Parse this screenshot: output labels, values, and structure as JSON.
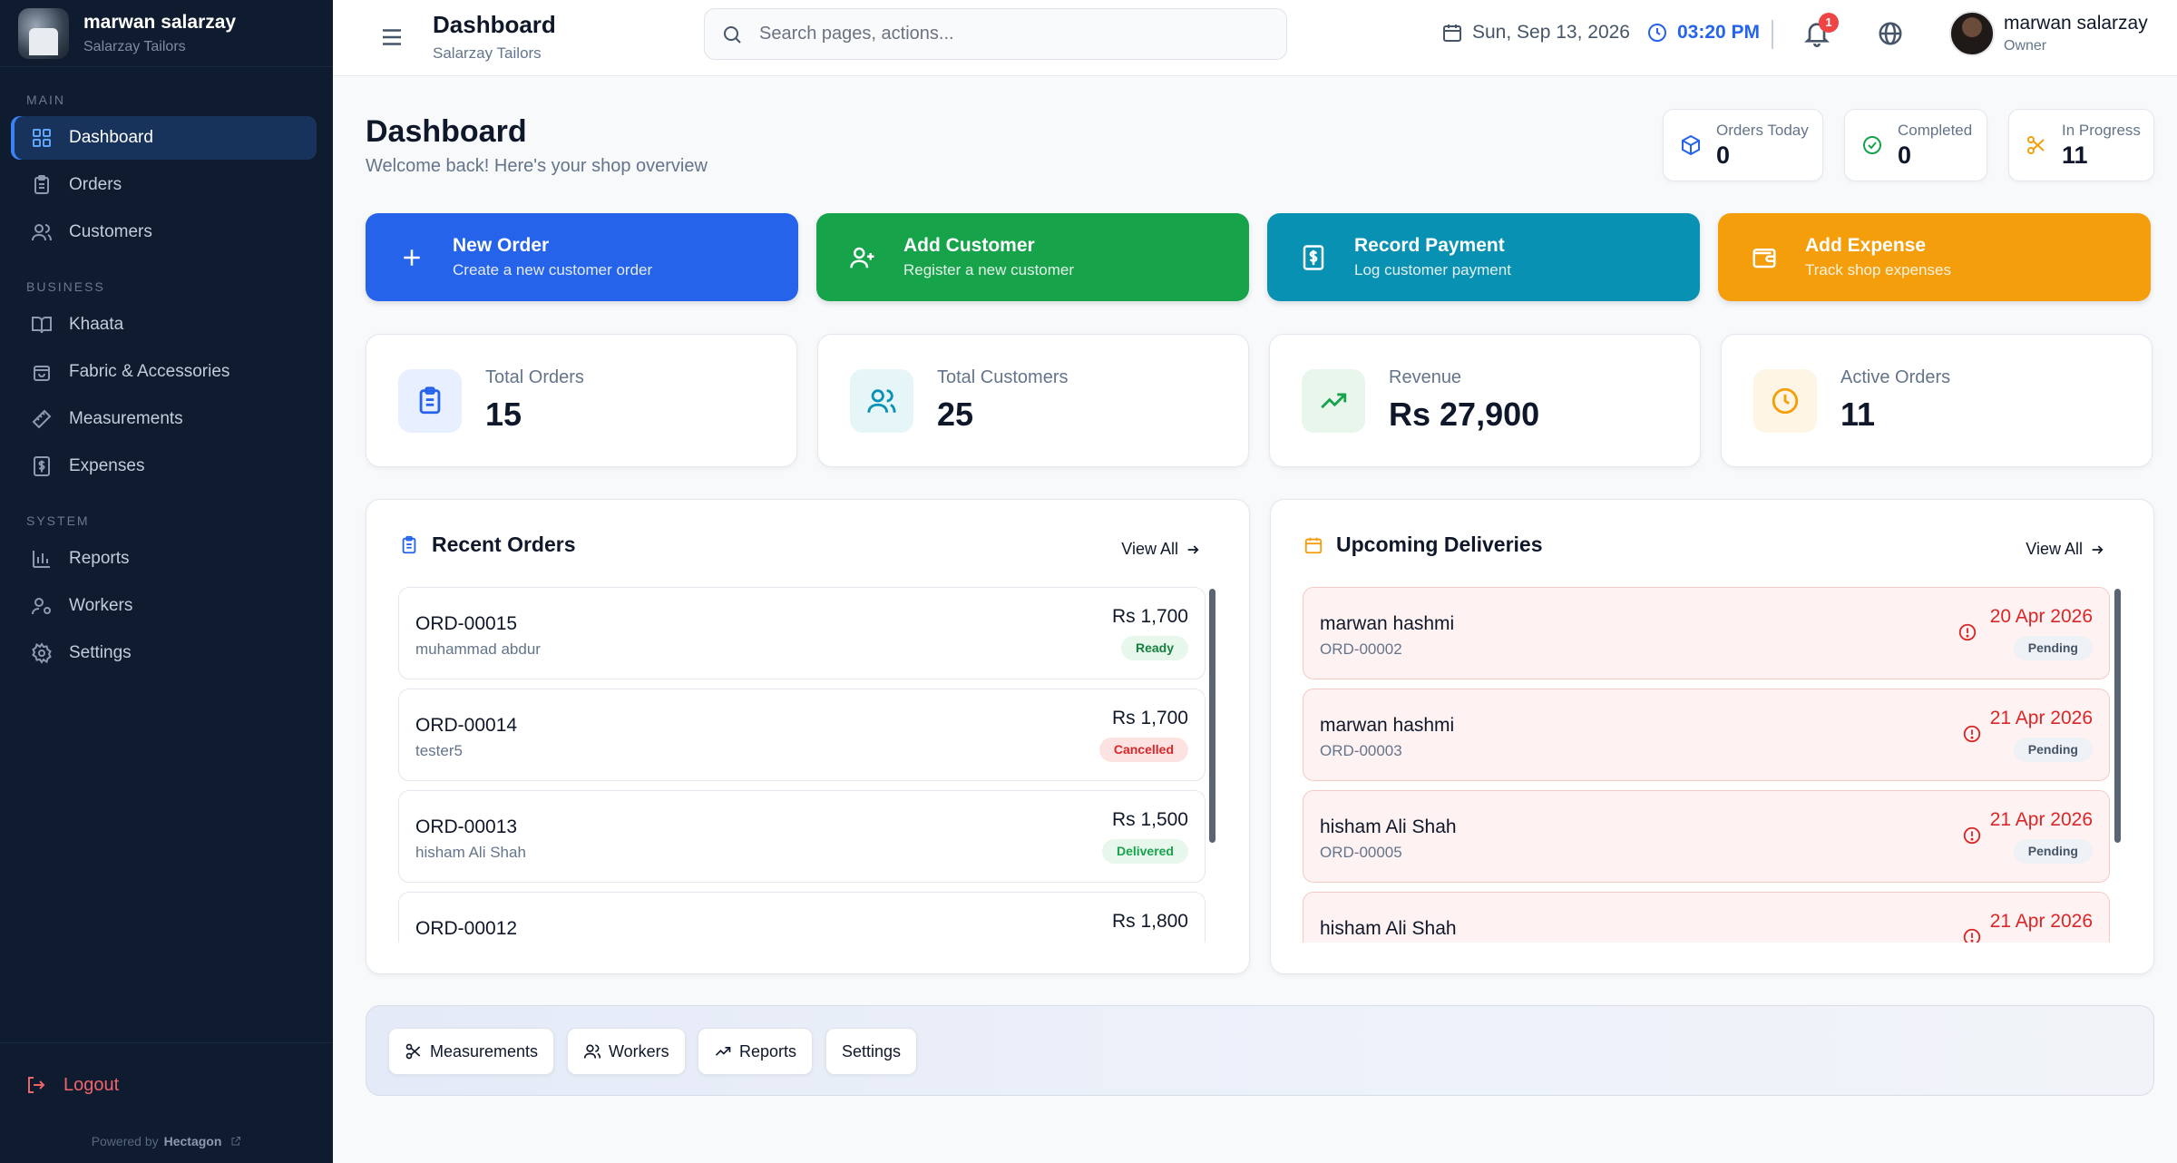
{
  "brand": {
    "name": "marwan salarzay",
    "subtitle": "Salarzay Tailors"
  },
  "nav": {
    "main_label": "MAIN",
    "business_label": "BUSINESS",
    "system_label": "SYSTEM",
    "dashboard": "Dashboard",
    "orders": "Orders",
    "customers": "Customers",
    "khaata": "Khaata",
    "fabric": "Fabric & Accessories",
    "measurements": "Measurements",
    "expenses": "Expenses",
    "reports": "Reports",
    "workers": "Workers",
    "settings": "Settings",
    "logout": "Logout",
    "powered_by": "Powered by",
    "powered_name": "Hectagon"
  },
  "header": {
    "title": "Dashboard",
    "subtitle": "Salarzay Tailors",
    "search_placeholder": "Search pages, actions...",
    "date": "Sun, Sep 13, 2026",
    "time": "03:20 PM",
    "notification_count": "1",
    "user_name": "marwan salarzay",
    "user_role": "Owner"
  },
  "page": {
    "title": "Dashboard",
    "subtitle": "Welcome back! Here's your shop overview"
  },
  "mini_stats": {
    "orders_today": {
      "label": "Orders Today",
      "value": "0"
    },
    "completed": {
      "label": "Completed",
      "value": "0"
    },
    "in_progress": {
      "label": "In Progress",
      "value": "11"
    }
  },
  "actions": {
    "new_order": {
      "title": "New Order",
      "sub": "Create a new customer order",
      "color": "#2563eb"
    },
    "add_customer": {
      "title": "Add Customer",
      "sub": "Register a new customer",
      "color": "#16a34a"
    },
    "record_payment": {
      "title": "Record Payment",
      "sub": "Log customer payment",
      "color": "#0891b2"
    },
    "add_expense": {
      "title": "Add Expense",
      "sub": "Track shop expenses",
      "color": "#f59e0b"
    }
  },
  "stats": {
    "total_orders": {
      "label": "Total Orders",
      "value": "15"
    },
    "total_customers": {
      "label": "Total Customers",
      "value": "25"
    },
    "revenue": {
      "label": "Revenue",
      "value": "Rs 27,900"
    },
    "active_orders": {
      "label": "Active Orders",
      "value": "11"
    }
  },
  "recent_orders": {
    "title": "Recent Orders",
    "view_all": "View All",
    "items": [
      {
        "id": "ORD-00015",
        "customer": "muhammad abdur",
        "amount": "Rs 1,700",
        "status": "Ready"
      },
      {
        "id": "ORD-00014",
        "customer": "tester5",
        "amount": "Rs 1,700",
        "status": "Cancelled"
      },
      {
        "id": "ORD-00013",
        "customer": "hisham Ali Shah",
        "amount": "Rs 1,500",
        "status": "Delivered"
      },
      {
        "id": "ORD-00012",
        "customer": "",
        "amount": "Rs 1,800",
        "status": ""
      }
    ]
  },
  "upcoming": {
    "title": "Upcoming Deliveries",
    "view_all": "View All",
    "items": [
      {
        "name": "marwan hashmi",
        "order": "ORD-00002",
        "date": "20 Apr 2026",
        "status": "Pending"
      },
      {
        "name": "marwan hashmi",
        "order": "ORD-00003",
        "date": "21 Apr 2026",
        "status": "Pending"
      },
      {
        "name": "hisham Ali Shah",
        "order": "ORD-00005",
        "date": "21 Apr 2026",
        "status": "Pending"
      },
      {
        "name": "hisham Ali Shah",
        "order": "",
        "date": "21 Apr 2026",
        "status": ""
      }
    ]
  },
  "quick_links": {
    "measurements": "Measurements",
    "workers": "Workers",
    "reports": "Reports",
    "settings": "Settings"
  }
}
